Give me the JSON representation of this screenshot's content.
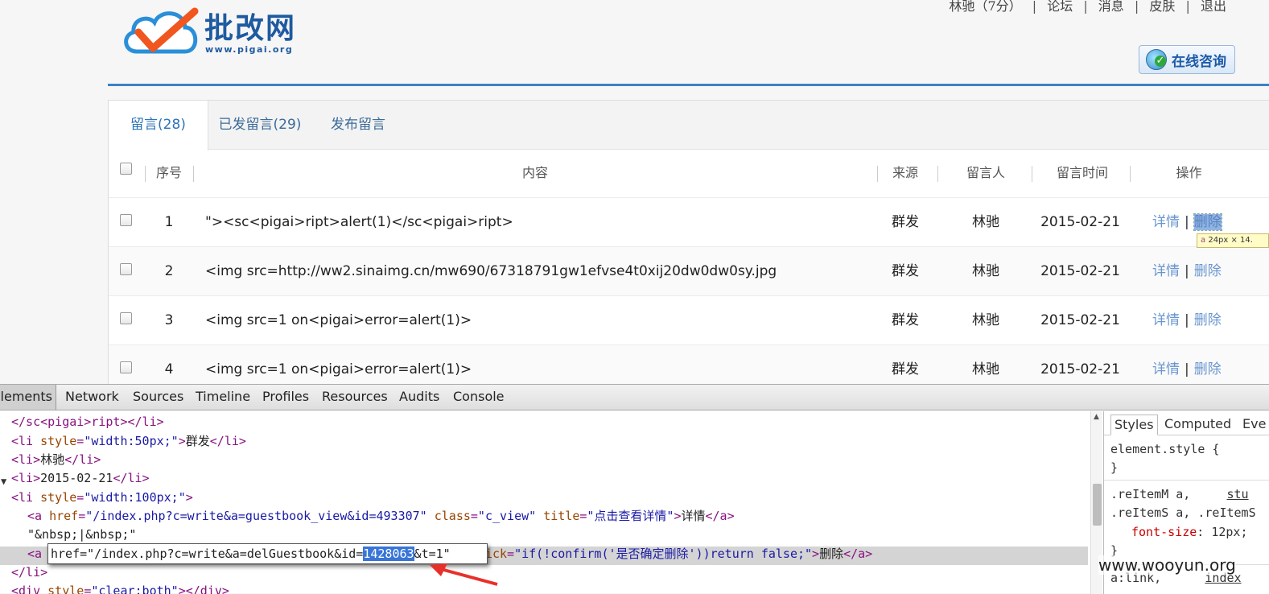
{
  "header": {
    "logo_text": "批改网",
    "logo_url": "www.pigai.org",
    "user_name": "林驰",
    "user_score": "（7分）",
    "forum": "论坛",
    "messages": "消息",
    "skin": "皮肤",
    "logout": "退出",
    "separator": "|",
    "consult_label": "在线咨询"
  },
  "tabs": [
    {
      "label": "留言(28)",
      "active": true
    },
    {
      "label": "已发留言(29)",
      "active": false
    },
    {
      "label": "发布留言",
      "active": false
    }
  ],
  "table": {
    "headers": {
      "seq": "序号",
      "content": "内容",
      "source": "来源",
      "author": "留言人",
      "time": "留言时间",
      "action": "操作"
    },
    "rows": [
      {
        "seq": "1",
        "content": "\"><sc<pigai>ript>alert(1)</sc<pigai>ript>",
        "source": "群发",
        "author": "林驰",
        "time": "2015-02-21",
        "detail": "详情",
        "delete": "删除"
      },
      {
        "seq": "2",
        "content": "<img src=http://ww2.sinaimg.cn/mw690/67318791gw1efvse4t0xij20dw0dw0sy.jpg",
        "source": "群发",
        "author": "林驰",
        "time": "2015-02-21",
        "detail": "详情",
        "delete": "删除"
      },
      {
        "seq": "3",
        "content": "<img src=1 on<pigai>error=alert(1)>",
        "source": "群发",
        "author": "林驰",
        "time": "2015-02-21",
        "detail": "详情",
        "delete": "删除"
      },
      {
        "seq": "4",
        "content": "<img src=1 on<pigai>error=alert(1)>",
        "source": "群发",
        "author": "林驰",
        "time": "2015-02-21",
        "detail": "详情",
        "delete": "删除"
      }
    ],
    "action_separator": "|"
  },
  "tooltip": {
    "tag": "a",
    "size": "24px × 14."
  },
  "devtools": {
    "tabs": [
      "Elements",
      "Network",
      "Sources",
      "Timeline",
      "Profiles",
      "Resources",
      "Audits",
      "Console"
    ],
    "active_tab": "Elements",
    "styles_tabs": [
      "Styles",
      "Computed",
      "Eve"
    ],
    "element_style": "element.style {",
    "close_brace": "}",
    "rule_selector_1": ".reItemM a,",
    "rule_link_1": "stu",
    "rule_selector_2": ".reItemS a, .reItemS",
    "rule_prop": "font-size",
    "rule_value": ": 12px;",
    "link_selector": "a:link,",
    "link_source": "index",
    "editing_prefix": "href=\"/index.php?c=write&a=delGuestbook&id=",
    "editing_selected": "1428063",
    "editing_suffix": "&t=1\""
  },
  "watermark": "www.wooyun.org",
  "colors": {
    "accent": "#3a82c4",
    "link": "#6a96cf",
    "selection": "#3875d7",
    "annotation_arrow": "#e8302a"
  }
}
